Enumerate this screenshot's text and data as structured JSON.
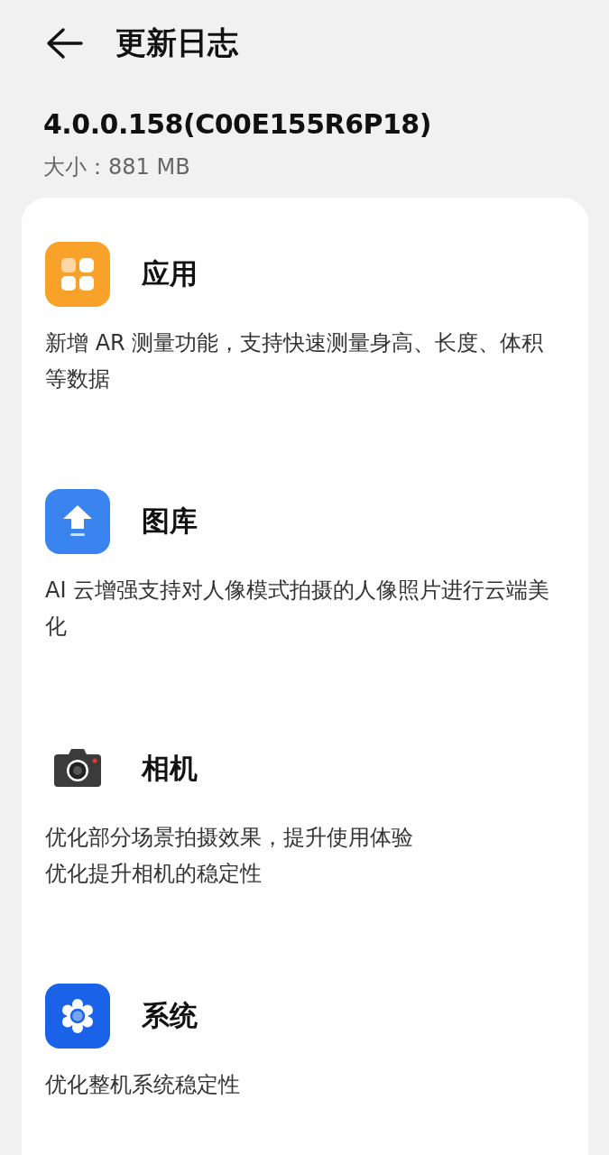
{
  "header": {
    "title": "更新日志"
  },
  "version": "4.0.0.158(C00E155R6P18)",
  "size": "大小：881 MB",
  "sections": [
    {
      "kind": "apps",
      "title": "应用",
      "lines": [
        "新增 AR 测量功能，支持快速测量身高、长度、体积等数据"
      ]
    },
    {
      "kind": "gallery",
      "title": "图库",
      "lines": [
        "AI 云增强支持对人像模式拍摄的人像照片进行云端美化"
      ]
    },
    {
      "kind": "camera",
      "title": "相机",
      "lines": [
        "优化部分场景拍摄效果，提升使用体验",
        "优化提升相机的稳定性"
      ]
    },
    {
      "kind": "settings",
      "title": "系统",
      "lines": [
        "优化整机系统稳定性"
      ]
    }
  ]
}
